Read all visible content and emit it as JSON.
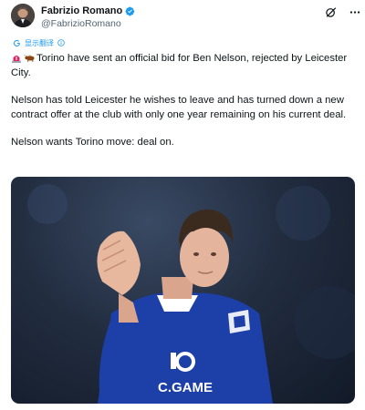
{
  "author": {
    "display_name": "Fabrizio Romano",
    "handle": "@FabrizioRomano",
    "verified": true
  },
  "actions": {
    "grok_icon": "grok-icon",
    "more_icon": "more-icon"
  },
  "translate": {
    "label": "显示翻译"
  },
  "tweet": {
    "line1": "Torino have sent an official bid for Ben Nelson, rejected by Leicester City.",
    "line2": "Nelson has told Leicester he wishes to leave and has turned down a new contract offer at the club with only one year remaining on his current deal.",
    "line3": "Nelson wants Torino move: deal on."
  },
  "media": {
    "jersey_sponsor": "C.GAME"
  },
  "colors": {
    "accent": "#1d9bf0",
    "text": "#0f1419",
    "muted": "#536471",
    "jersey": "#1d3fa8"
  }
}
